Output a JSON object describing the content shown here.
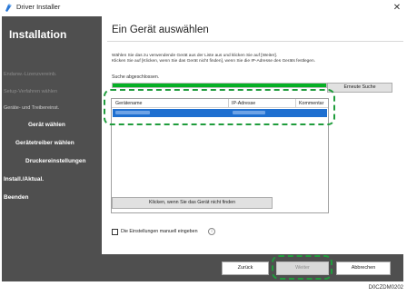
{
  "window": {
    "title": "Driver Installer",
    "close_glyph": "✕"
  },
  "sidebar": {
    "heading": "Installation",
    "items": [
      {
        "label": "Endanw.-Lizenzvereinb."
      },
      {
        "label": "Setup-Verfahren wählen"
      },
      {
        "label": "Geräte- und Treibereinst."
      }
    ],
    "subitems": [
      {
        "label": "Gerät wählen"
      },
      {
        "label": "Gerätetreiber wählen"
      },
      {
        "label": "Druckereinstellungen"
      }
    ],
    "bold_items": [
      {
        "label": "Install./Aktual."
      },
      {
        "label": "Beenden"
      }
    ]
  },
  "main": {
    "title": "Ein Gerät auswählen",
    "instruction_line1": "Wählen Sie das zu verwendende Gerät aus der Liste aus und klicken Sie auf [Weiter].",
    "instruction_line2": "Klicken Sie auf [Klicken, wenn Sie das Gerät nicht finden], wenn Sie die IP-Adresse des Geräts festlegen.",
    "search_status": "Suche abgeschlossen.",
    "progress_percent": 100,
    "research_button": "Erneute Suche",
    "table": {
      "columns": [
        "Gerätename",
        "IP-Adresse",
        "Kommentar"
      ],
      "selected_row_index": 0
    },
    "not_found_button": "Klicken, wenn Sie das Gerät nicht finden",
    "manual_checkbox_label": "Die Einstellungen manuell eingeben",
    "manual_checkbox_checked": false,
    "info_glyph": "i"
  },
  "footer": {
    "back_button": "Zurück",
    "next_button": "Weiter",
    "cancel_button": "Abbrechen"
  },
  "figure_code": "D0CZDM0202",
  "colors": {
    "sidebar_bg": "#4f4f4f",
    "selection": "#1e6fd0",
    "highlight_dash": "#1f9c3c",
    "progress_fill": "#06b025"
  },
  "icons": {
    "app": "installer-app-icon",
    "close": "close-icon",
    "info": "info-icon"
  }
}
